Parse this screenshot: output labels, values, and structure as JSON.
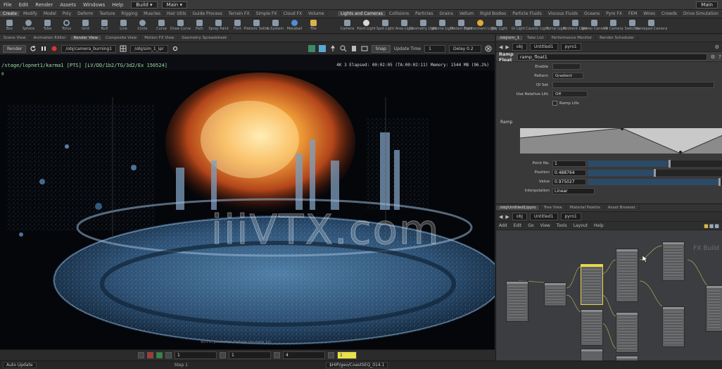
{
  "menubar": {
    "items": [
      "File",
      "Edit",
      "Render",
      "Assets",
      "Windows",
      "Help"
    ],
    "desktop": "Build",
    "context": "Main",
    "right_label": "Main"
  },
  "shelf_left": {
    "tabs": [
      "Create",
      "Modify",
      "Model",
      "Poly",
      "Deform",
      "Texture",
      "Rigging",
      "Muscles",
      "Hair Utils",
      "Guide Process",
      "Terrain FX",
      "Simple FX",
      "Cloud FX",
      "Volume"
    ],
    "active_tab": 0,
    "tools": [
      "Box",
      "Sphere",
      "Tube",
      "Torus",
      "Grid",
      "Null",
      "Line",
      "Circle",
      "Curve",
      "Draw Curve",
      "Path",
      "Spray Paint",
      "Font",
      "Platonic Solids",
      "L-System",
      "Metaball",
      "File"
    ]
  },
  "shelf_right": {
    "tabs": [
      "Lights and Cameras",
      "Collisions",
      "Particles",
      "Grains",
      "Vellum",
      "Rigid Bodies",
      "Particle Fluids",
      "Viscous Fluids",
      "Oceans",
      "Pyro FX",
      "FEM",
      "Wires",
      "Crowds",
      "Drive Simulation"
    ],
    "active_tab": 0,
    "tools": [
      "Camera",
      "Point Light",
      "Spot Light",
      "Area Light",
      "Geometry Light",
      "Volume Light",
      "Distant Light",
      "Environment Light",
      "Sky Light",
      "GI Light",
      "Caustic Light",
      "Portal Light",
      "Ambient Light",
      "Stereo Camera",
      "VR Camera",
      "Switcher",
      "Gamepad Camera"
    ]
  },
  "viewport_tabs": [
    "Scene View",
    "Animation Editor",
    "Render View",
    "Composite View",
    "Motion FX View",
    "Geometry Spreadsheet"
  ],
  "viewport_tabs_active": 2,
  "viewport_toolbar": {
    "render_btn": "Render",
    "camera": "/obj/camera_burning1",
    "rop": "/obj/sim_1_ipr",
    "snapshot_btn": "Snap",
    "update_label": "Update Time",
    "update_value": "1",
    "delay_label": "Delay 0.2"
  },
  "viewport": {
    "path_line": "/stage/lopnet1/karma1  [PTS]  [LV/DD/1b2/TG/3d2/Ex 150524]",
    "stats_line": "4K 3  Elapsed: 00:02:05  (TA:00:02:11)  Memory: 1544 MB  (96.2%)",
    "side_line": "0",
    "caption": "SO-FX, production footage (no more 1s)"
  },
  "playbar": {
    "frame_start": "1",
    "frame_cur": "1",
    "frame_end": "4",
    "frame_yellow": "1"
  },
  "statusbar": {
    "left": "Auto Update",
    "frame_label": "Step 1",
    "path": "$HIP/geo/CoastSEQ_014.1"
  },
  "param_pane": {
    "tabs": [
      "/obj/sim_1",
      "Take List",
      "Performance Monitor",
      "Render Scheduler"
    ],
    "active_tab": 0,
    "path_items": [
      "obj",
      "Untitled1",
      "pyro1"
    ],
    "node_type": "Ramp Float",
    "node_name": "ramp_float1",
    "rows": [
      {
        "label": "Enable",
        "value": ""
      },
      {
        "label": "Pattern",
        "value": "Gradient"
      },
      {
        "label": "Of Set",
        "value": ""
      },
      {
        "label": "Use Relative Lifs",
        "value": "Off"
      },
      {
        "label": "Ramp Life",
        "value": ""
      }
    ],
    "ramp_label": "Ramp",
    "point_no_label": "Point No.",
    "point_no_value": "1",
    "position_label": "Position",
    "position_value": "0.488764",
    "value_label": "Value",
    "value_value": "0.975027",
    "interp_label": "Interpolation",
    "interp_value": "Linear"
  },
  "network_pane": {
    "tabs": [
      "/obj/Untitled1/pyro",
      "Tree View",
      "Material Palette",
      "Asset Browser"
    ],
    "active_tab": 0,
    "menu": [
      "Add",
      "Edit",
      "Go",
      "View",
      "Tools",
      "Layout",
      "Help"
    ],
    "path_items": [
      "obj",
      "Untitled1",
      "pyro1"
    ],
    "corner_text": "FX Build"
  },
  "watermark": "iiiVTX.com"
}
